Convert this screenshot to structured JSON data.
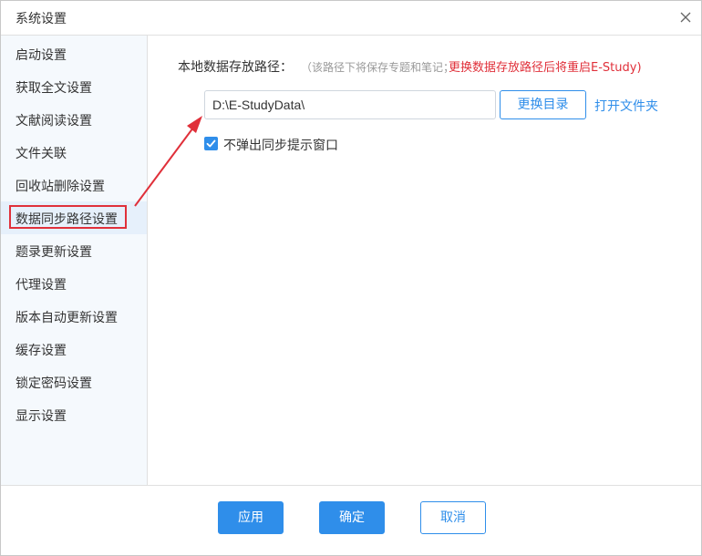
{
  "window": {
    "title": "系统设置",
    "close_icon": "close-icon"
  },
  "sidebar": {
    "items": [
      {
        "label": "启动设置"
      },
      {
        "label": "获取全文设置"
      },
      {
        "label": "文献阅读设置"
      },
      {
        "label": "文件关联"
      },
      {
        "label": "回收站删除设置"
      },
      {
        "label": "数据同步路径设置",
        "active": true
      },
      {
        "label": "题录更新设置"
      },
      {
        "label": "代理设置"
      },
      {
        "label": "版本自动更新设置"
      },
      {
        "label": "缓存设置"
      },
      {
        "label": "锁定密码设置"
      },
      {
        "label": "显示设置"
      }
    ]
  },
  "content": {
    "path_label": "本地数据存放路径：",
    "path_hint": "（该路径下将保存专题和笔记；",
    "path_warning": "更换数据存放路径后将重启E-Study)",
    "path_value": "D:\\E-StudyData\\",
    "change_dir_label": "更换目录",
    "open_folder_label": "打开文件夹",
    "no_popup_checked": true,
    "no_popup_label": "不弹出同步提示窗口"
  },
  "footer": {
    "apply_label": "应用",
    "ok_label": "确定",
    "cancel_label": "取消"
  },
  "colors": {
    "accent": "#2f8eea",
    "warning": "#e0303a",
    "sidebar_bg": "#f5f9fd"
  }
}
